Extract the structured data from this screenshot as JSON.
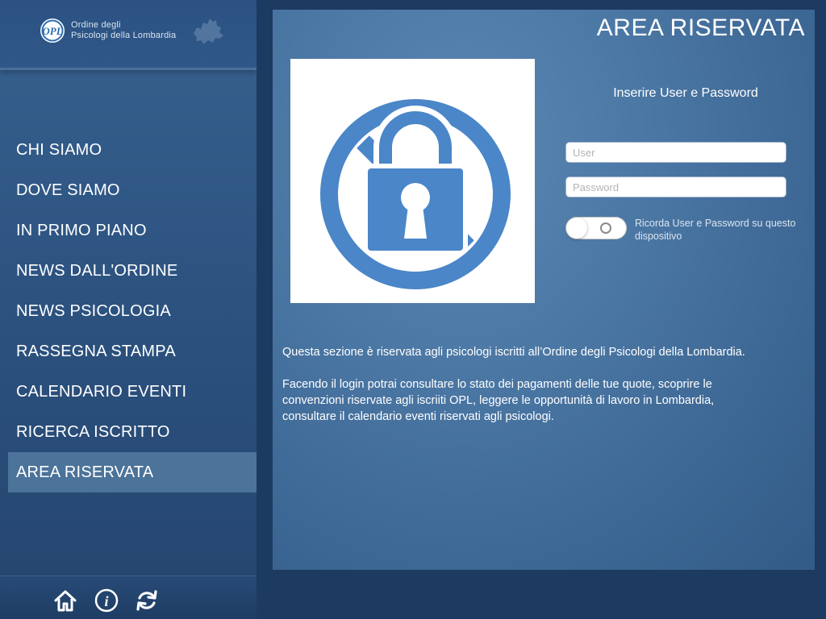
{
  "brand": {
    "logo_initials": "OPL",
    "name_line1": "Ordine degli",
    "name_line2": "Psicologi della Lombardia"
  },
  "nav": {
    "items": [
      {
        "label": "CHI SIAMO"
      },
      {
        "label": "DOVE SIAMO"
      },
      {
        "label": "IN PRIMO PIANO"
      },
      {
        "label": "NEWS DALL'ORDINE"
      },
      {
        "label": "NEWS PSICOLOGIA"
      },
      {
        "label": "RASSEGNA STAMPA"
      },
      {
        "label": "CALENDARIO EVENTI"
      },
      {
        "label": "RICERCA ISCRITTO"
      },
      {
        "label": "AREA RISERVATA",
        "active": true
      }
    ]
  },
  "footer": {
    "icons": [
      "home-icon",
      "info-icon",
      "refresh-icon"
    ]
  },
  "main": {
    "title": "AREA RISERVATA",
    "login_prompt": "Inserire User e Password",
    "user_placeholder": "User",
    "user_value": "",
    "password_placeholder": "Password",
    "password_value": "",
    "remember_label": "Ricorda User e Password su questo dispositivo",
    "remember_enabled": false,
    "description": {
      "p1": "Questa sezione  è riservata agli psicologi iscritti all’Ordine degli Psicologi della Lombardia.",
      "p2": "Facendo il login potrai consultare lo stato dei pagamenti delle tue quote, scoprire le convenzioni riservate agli iscriiti OPL, leggere le opportunità di lavoro in Lombardia, consultare il calendario eventi riservati agli psicologi."
    }
  },
  "colors": {
    "sidebar": "#2d5381",
    "active_item": "#4c7399",
    "panel": "#4a76a3",
    "icon_blue": "#4a86c8"
  }
}
